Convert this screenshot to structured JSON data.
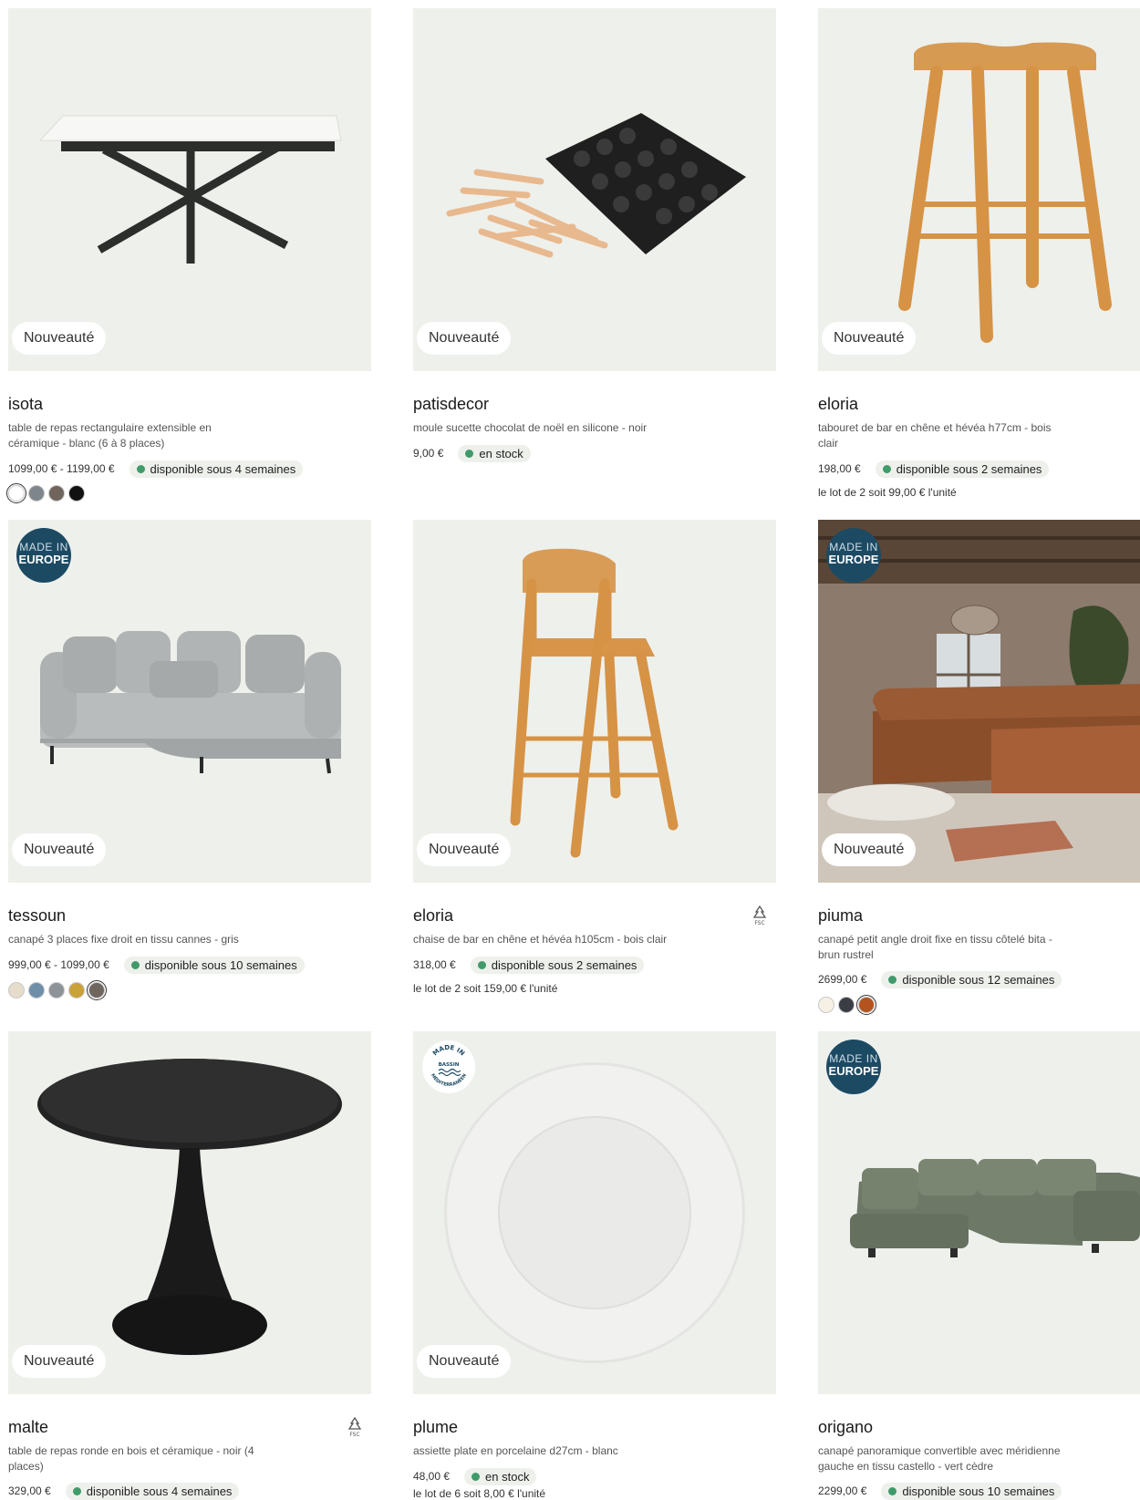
{
  "nouveaute_label": "Nouveauté",
  "made_in_europe": {
    "line1": "MADE IN",
    "line2": "EUROPE"
  },
  "made_in_bassin": {
    "line1": "MADE IN",
    "line2": "BASSIN",
    "line3": "MÉDITERRANÉEN"
  },
  "fsc_label": "FSC",
  "products": [
    {
      "title": "isota",
      "desc": "table de repas rectangulaire extensible en céramique - blanc (6 à 8 places)",
      "price": "1099,00 € - 1199,00 €",
      "availability": "disponible sous 4 semaines",
      "lot": "",
      "swatches": [
        "#ffffff",
        "#7e868c",
        "#6f655c",
        "#111111"
      ]
    },
    {
      "title": "patisdecor",
      "desc": "moule sucette chocolat de noël en silicone - noir",
      "price": "9,00 €",
      "availability": "en stock",
      "lot": "",
      "swatches": []
    },
    {
      "title": "eloria",
      "desc": "tabouret de bar en chêne et hévéa h77cm - bois clair",
      "price": "198,00 €",
      "availability": "disponible sous 2 semaines",
      "lot": "le lot de 2 soit 99,00 € l'unité",
      "swatches": []
    },
    {
      "title": "tessoun",
      "desc": "canapé 3 places fixe droit en tissu cannes - gris",
      "price": "999,00 € - 1099,00 €",
      "availability": "disponible sous 10 semaines",
      "lot": "",
      "swatches": [
        "#e6dccb",
        "#6f8ea8",
        "#8d9399",
        "#c9a23a",
        "#6f665e"
      ]
    },
    {
      "title": "eloria",
      "desc": "chaise de bar en chêne et hévéa h105cm - bois clair",
      "price": "318,00 €",
      "availability": "disponible sous 2 semaines",
      "lot": "le lot de 2 soit 159,00 € l'unité",
      "swatches": []
    },
    {
      "title": "piuma",
      "desc": "canapé petit angle droit fixe en tissu côtelé bita - brun rustrel",
      "price": "2699,00 €",
      "availability": "disponible sous 12 semaines",
      "lot": "",
      "swatches": [
        "#f6f1e4",
        "#3a3d44",
        "#b5531e"
      ]
    },
    {
      "title": "malte",
      "desc": "table de repas ronde en bois et céramique - noir (4 places)",
      "price": "329,00 €",
      "availability": "disponible sous 4 semaines",
      "lot": "",
      "swatches": []
    },
    {
      "title": "plume",
      "desc": "assiette plate en porcelaine d27cm - blanc",
      "price": "48,00 €",
      "availability": "en stock",
      "lot": "le lot de 6 soit 8,00 € l'unité",
      "swatches": []
    },
    {
      "title": "origano",
      "desc": "canapé panoramique convertible avec méridienne gauche en tissu castello - vert cèdre",
      "price": "2299,00 €",
      "availability": "disponible sous 10 semaines",
      "lot": "",
      "swatches": []
    }
  ],
  "colors": {
    "image_bg": "#eef0ec",
    "stock_dot": "#3f9b6a",
    "eu_badge": "#1d4a63"
  }
}
